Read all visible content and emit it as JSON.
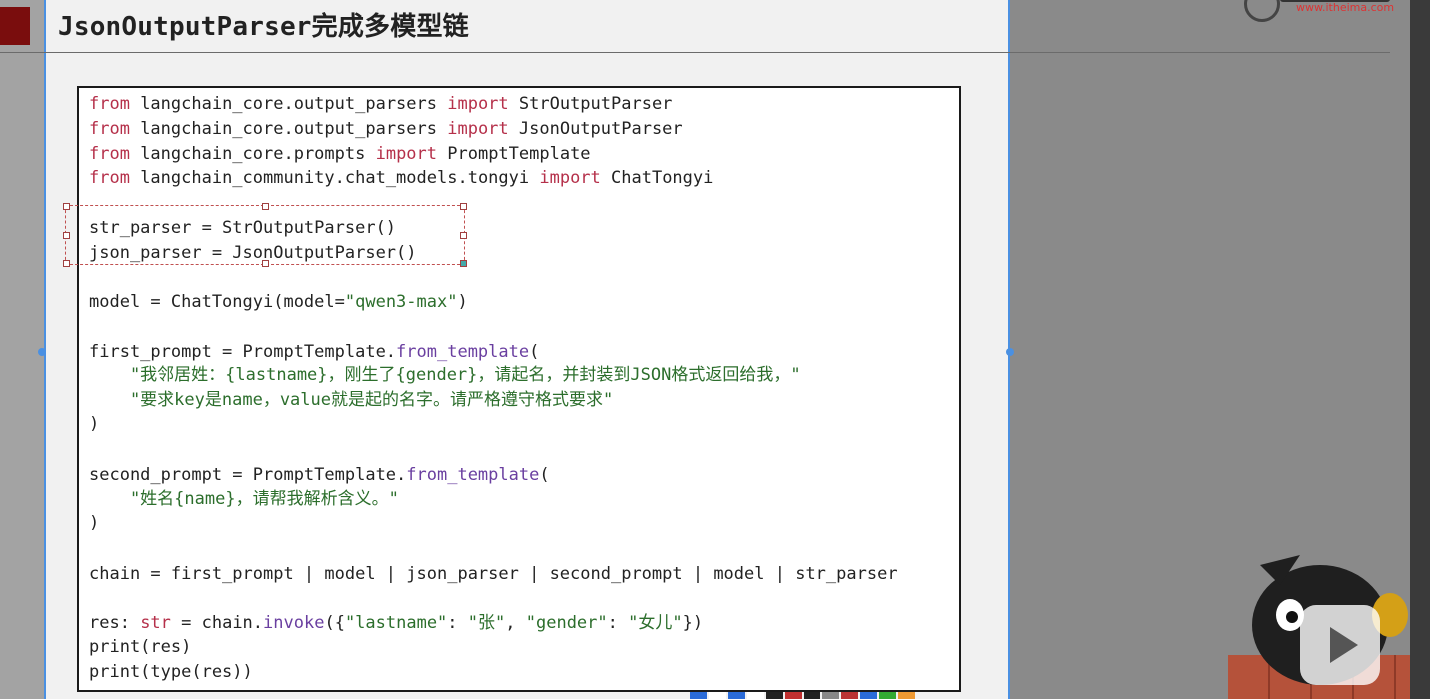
{
  "slide": {
    "title": "JsonOutputParser完成多模型链"
  },
  "logo": {
    "url": "www.itheima.com"
  },
  "code": {
    "lines": [
      [
        {
          "t": "from",
          "c": "kw"
        },
        {
          "t": " langchain_core.output_parsers ",
          "c": "cn"
        },
        {
          "t": "import",
          "c": "kw"
        },
        {
          "t": " StrOutputParser",
          "c": "cn"
        }
      ],
      [
        {
          "t": "from",
          "c": "kw"
        },
        {
          "t": " langchain_core.output_parsers ",
          "c": "cn"
        },
        {
          "t": "import",
          "c": "kw"
        },
        {
          "t": " JsonOutputParser",
          "c": "cn"
        }
      ],
      [
        {
          "t": "from",
          "c": "kw"
        },
        {
          "t": " langchain_core.prompts ",
          "c": "cn"
        },
        {
          "t": "import",
          "c": "kw"
        },
        {
          "t": " PromptTemplate",
          "c": "cn"
        }
      ],
      [
        {
          "t": "from",
          "c": "kw"
        },
        {
          "t": " langchain_community.chat_models.tongyi ",
          "c": "cn"
        },
        {
          "t": "import",
          "c": "kw"
        },
        {
          "t": " ChatTongyi",
          "c": "cn"
        }
      ],
      [],
      [
        {
          "t": "str_parser = StrOutputParser()",
          "c": "cn"
        }
      ],
      [
        {
          "t": "json_parser = JsonOutputParser()",
          "c": "cn"
        }
      ],
      [],
      [
        {
          "t": "model = ChatTongyi(model=",
          "c": "cn"
        },
        {
          "t": "\"qwen3-max\"",
          "c": "str"
        },
        {
          "t": ")",
          "c": "cn"
        }
      ],
      [],
      [
        {
          "t": "first_prompt = PromptTemplate.",
          "c": "cn"
        },
        {
          "t": "from_template",
          "c": "fn"
        },
        {
          "t": "(",
          "c": "cn"
        }
      ],
      [
        {
          "t": "    \"我邻居姓：{lastname}，刚生了{gender}，请起名，并封装到JSON格式返回给我，\"",
          "c": "str"
        }
      ],
      [
        {
          "t": "    \"要求key是name，value就是起的名字。请严格遵守格式要求\"",
          "c": "str"
        }
      ],
      [
        {
          "t": ")",
          "c": "cn"
        }
      ],
      [],
      [
        {
          "t": "second_prompt = PromptTemplate.",
          "c": "cn"
        },
        {
          "t": "from_template",
          "c": "fn"
        },
        {
          "t": "(",
          "c": "cn"
        }
      ],
      [
        {
          "t": "    \"姓名{name}，请帮我解析含义。\"",
          "c": "str"
        }
      ],
      [
        {
          "t": ")",
          "c": "cn"
        }
      ],
      [],
      [
        {
          "t": "chain = first_prompt | model | json_parser | second_prompt | model | str_parser",
          "c": "cn"
        }
      ],
      [],
      [
        {
          "t": "res: ",
          "c": "cn"
        },
        {
          "t": "str",
          "c": "kw"
        },
        {
          "t": " = chain.",
          "c": "cn"
        },
        {
          "t": "invoke",
          "c": "fn"
        },
        {
          "t": "({",
          "c": "cn"
        },
        {
          "t": "\"lastname\"",
          "c": "str"
        },
        {
          "t": ": ",
          "c": "cn"
        },
        {
          "t": "\"张\"",
          "c": "str"
        },
        {
          "t": ", ",
          "c": "cn"
        },
        {
          "t": "\"gender\"",
          "c": "str"
        },
        {
          "t": ": ",
          "c": "cn"
        },
        {
          "t": "\"女儿\"",
          "c": "str"
        },
        {
          "t": "})",
          "c": "cn"
        }
      ],
      [
        {
          "t": "print(res)",
          "c": "cn"
        }
      ],
      [
        {
          "t": "print(type(res))",
          "c": "cn"
        }
      ]
    ]
  },
  "colors": {
    "keyword": "#b5304a",
    "function": "#6a3fa0",
    "string": "#2c6e2c",
    "text": "#2b2b2b"
  }
}
